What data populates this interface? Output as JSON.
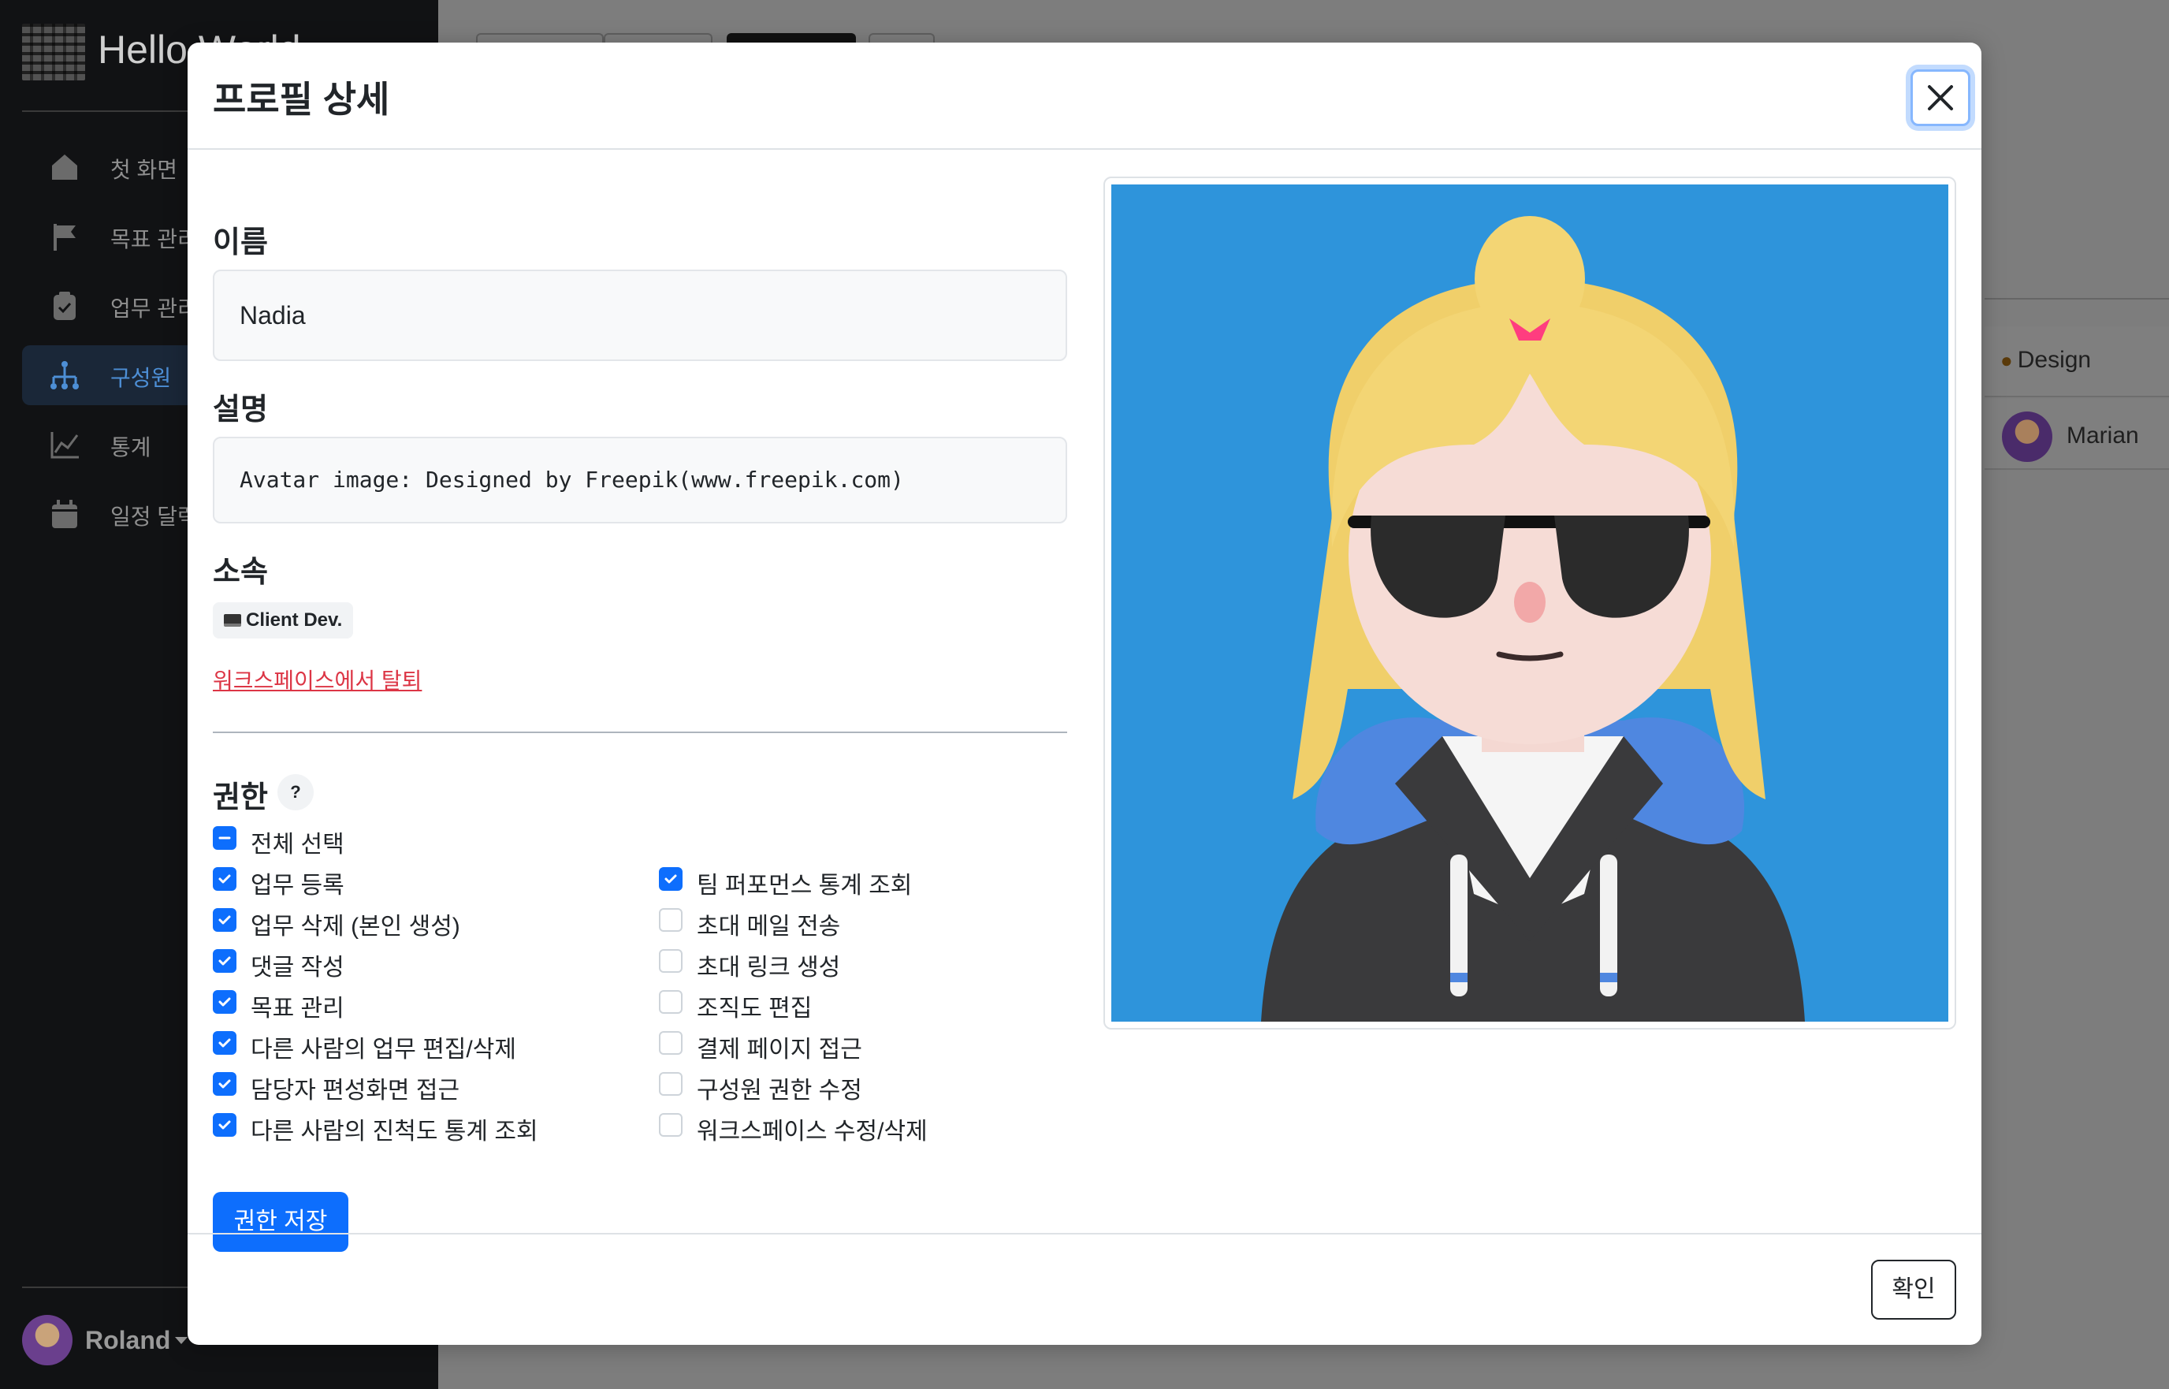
{
  "app": {
    "title": "Hello World",
    "nav": [
      {
        "label": "첫 화면",
        "icon": "home-icon"
      },
      {
        "label": "목표 관리",
        "icon": "flag-icon"
      },
      {
        "label": "업무 관리",
        "icon": "clipboard-check-icon"
      },
      {
        "label": "구성원",
        "icon": "org-chart-icon",
        "active": true
      },
      {
        "label": "통계",
        "icon": "line-chart-icon"
      },
      {
        "label": "일정 달력",
        "icon": "calendar-icon"
      }
    ],
    "user": {
      "name": "Roland"
    },
    "background_list": {
      "team_tag": "Design",
      "team_tag_icon": "palette-icon",
      "member_name": "Marian"
    }
  },
  "modal": {
    "title": "프로필 상세",
    "name_label": "이름",
    "name_value": "Nadia",
    "desc_label": "설명",
    "desc_value": "Avatar image: Designed by Freepik(www.freepik.com)",
    "team_label": "소속",
    "team_badge": "Client Dev.",
    "team_badge_icon": "laptop-icon",
    "leave_link": "워크스페이스에서 탈퇴",
    "permissions_label": "권한",
    "help_label": "?",
    "select_all": {
      "label": "전체 선택",
      "state": "indeterminate"
    },
    "permissions_left": [
      {
        "label": "업무 등록",
        "checked": true
      },
      {
        "label": "업무 삭제 (본인 생성)",
        "checked": true
      },
      {
        "label": "댓글 작성",
        "checked": true
      },
      {
        "label": "목표 관리",
        "checked": true
      },
      {
        "label": "다른 사람의 업무 편집/삭제",
        "checked": true
      },
      {
        "label": "담당자 편성화면 접근",
        "checked": true
      },
      {
        "label": "다른 사람의 진척도 통계 조회",
        "checked": true
      }
    ],
    "permissions_right": [
      {
        "label": "팀 퍼포먼스 통계 조회",
        "checked": true
      },
      {
        "label": "초대 메일 전송",
        "checked": false
      },
      {
        "label": "초대 링크 생성",
        "checked": false
      },
      {
        "label": "조직도 편집",
        "checked": false
      },
      {
        "label": "결제 페이지 접근",
        "checked": false
      },
      {
        "label": "구성원 권한 수정",
        "checked": false
      },
      {
        "label": "워크스페이스 수정/삭제",
        "checked": false
      }
    ],
    "save_permissions_label": "권한 저장",
    "confirm_label": "확인",
    "colors": {
      "primary": "#0d6efd",
      "danger": "#dc3545",
      "avatar_bg": "#2e94db"
    }
  }
}
